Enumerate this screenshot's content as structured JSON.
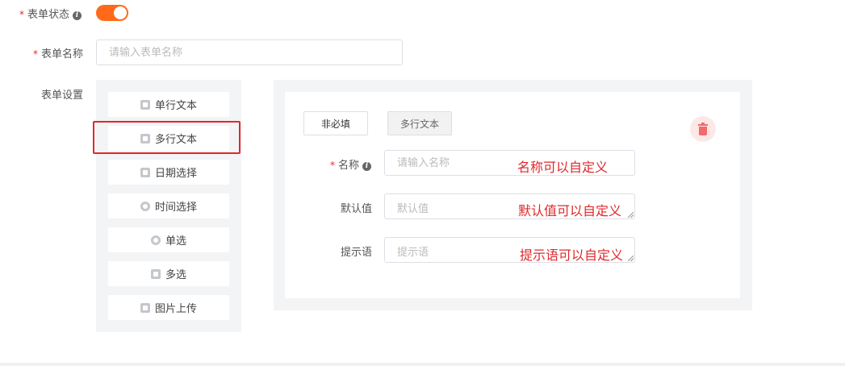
{
  "form": {
    "status_label": "表单状态",
    "status_on": true,
    "name_label": "表单名称",
    "name_placeholder": "请输入表单名称",
    "settings_label": "表单设置"
  },
  "palette": [
    {
      "label": "单行文本",
      "icon": "text-icon"
    },
    {
      "label": "多行文本",
      "icon": "textarea-icon",
      "selected": true
    },
    {
      "label": "日期选择",
      "icon": "calendar-icon"
    },
    {
      "label": "时间选择",
      "icon": "clock-icon"
    },
    {
      "label": "单选",
      "icon": "radio-icon"
    },
    {
      "label": "多选",
      "icon": "checkbox-icon"
    },
    {
      "label": "图片上传",
      "icon": "image-icon"
    }
  ],
  "config": {
    "required_button": "非必填",
    "type_button": "多行文本",
    "name_label": "名称",
    "name_placeholder": "请输入名称",
    "name_annotation": "名称可以自定义",
    "default_label": "默认值",
    "default_placeholder": "默认值",
    "default_annotation": "默认值可以自定义",
    "hint_label": "提示语",
    "hint_placeholder": "提示语",
    "hint_annotation": "提示语可以自定义"
  },
  "colors": {
    "accent": "#ff6a1a",
    "required": "#f5222d",
    "annotation": "#e0282b",
    "delete": "#f16b6b"
  }
}
